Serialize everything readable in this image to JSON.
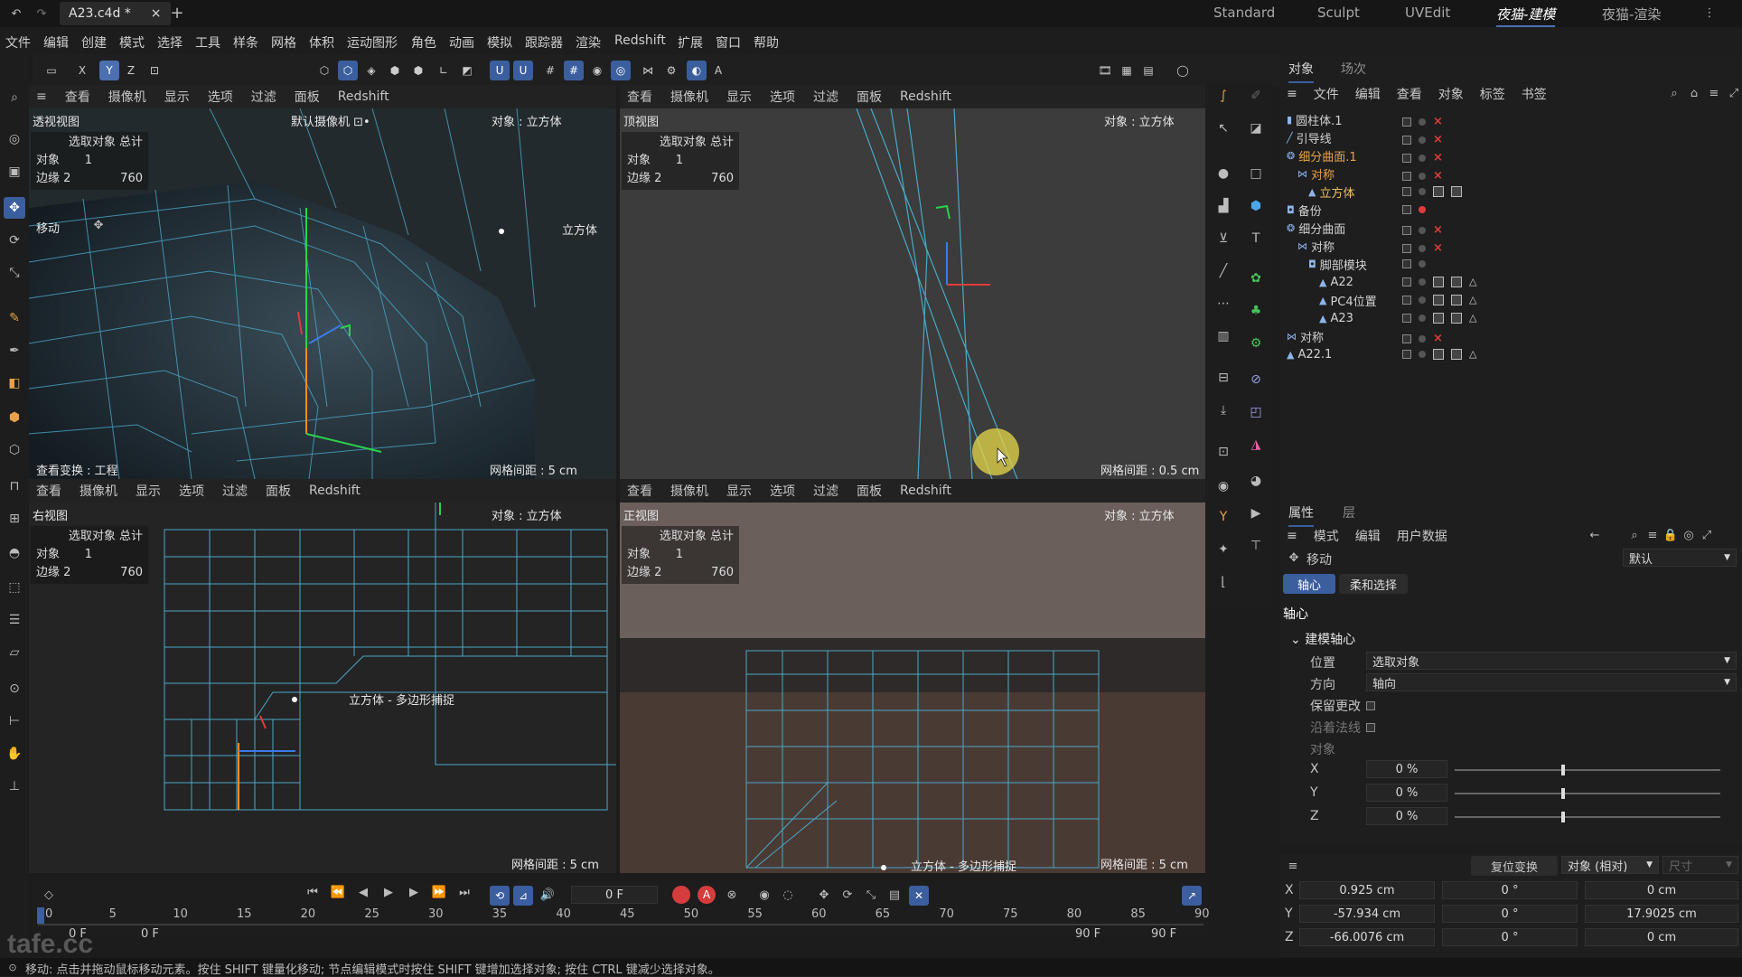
{
  "titlebar": {
    "doc_tab": "A23.c4d *",
    "layouts": [
      "Standard",
      "Sculpt",
      "UVEdit",
      "夜猫-建模",
      "夜猫-渲染"
    ]
  },
  "menu": [
    "文件",
    "编辑",
    "创建",
    "模式",
    "选择",
    "工具",
    "样条",
    "网格",
    "体积",
    "运动图形",
    "角色",
    "动画",
    "模拟",
    "跟踪器",
    "渲染",
    "Redshift",
    "扩展",
    "窗口",
    "帮助"
  ],
  "toolbar": {
    "x": "X",
    "y": "Y",
    "z": "Z"
  },
  "viewport_menu": [
    "查看",
    "摄像机",
    "显示",
    "选项",
    "过滤",
    "面板",
    "Redshift"
  ],
  "viewports": [
    {
      "name": "透视视图",
      "camera": "默认摄像机 ⊡•",
      "object": "对象 : 立方体",
      "grid": "网格间距 : 5 cm",
      "extra": "查看变换 : 工程",
      "label3d": "立方体",
      "tool": "移动"
    },
    {
      "name": "顶视图",
      "object": "对象 : 立方体",
      "grid": "网格间距 : 0.5 cm"
    },
    {
      "name": "右视图",
      "object": "对象 : 立方体",
      "grid": "网格间距 : 5 cm",
      "label3d": "立方体 - 多边形捕捉"
    },
    {
      "name": "正视图",
      "object": "对象 : 立方体",
      "grid": "网格间距 : 5 cm",
      "label3d": "立方体 - 多边形捕捉"
    }
  ],
  "stats": {
    "header": "选取对象 总计",
    "obj_label": "对象",
    "obj_val": "1",
    "edge_label": "边缘",
    "edge_val": "2",
    "edge_total": "760"
  },
  "object_panel": {
    "tabs": [
      "对象",
      "场次"
    ],
    "menu": [
      "文件",
      "编辑",
      "查看",
      "对象",
      "标签",
      "书签"
    ],
    "items": [
      {
        "name": "圆柱体.1",
        "indent": 0,
        "color": "#d2d2d2"
      },
      {
        "name": "引导线",
        "indent": 0,
        "color": "#d2d2d2"
      },
      {
        "name": "细分曲面.1",
        "indent": 0,
        "color": "#e8a24a"
      },
      {
        "name": "对称",
        "indent": 1,
        "color": "#e8a24a"
      },
      {
        "name": "立方体",
        "indent": 2,
        "color": "#f0c060"
      },
      {
        "name": "备份",
        "indent": 0,
        "color": "#d2d2d2"
      },
      {
        "name": "细分曲面",
        "indent": 0,
        "color": "#d2d2d2"
      },
      {
        "name": "对称",
        "indent": 1,
        "color": "#d2d2d2"
      },
      {
        "name": "脚部模块",
        "indent": 2,
        "color": "#d2d2d2"
      },
      {
        "name": "A22",
        "indent": 3,
        "color": "#d2d2d2"
      },
      {
        "name": "PC4位置",
        "indent": 3,
        "color": "#d2d2d2"
      },
      {
        "name": "A23",
        "indent": 3,
        "color": "#d2d2d2"
      },
      {
        "name": "对称",
        "indent": 0,
        "color": "#d2d2d2"
      },
      {
        "name": "A22.1",
        "indent": 0,
        "color": "#d2d2d2"
      }
    ]
  },
  "attr_panel": {
    "tabs": [
      "属性",
      "层"
    ],
    "menu": [
      "模式",
      "编辑",
      "用户数据"
    ],
    "tool": "移动",
    "preset": "默认",
    "subtabs": [
      "轴心",
      "柔和选择"
    ],
    "section": "轴心",
    "group": "建模轴心",
    "position_label": "位置",
    "position_value": "选取对象",
    "direction_label": "方向",
    "direction_value": "轴向",
    "keep_changes": "保留更改",
    "along_normal": "沿着法线",
    "object_label": "对象",
    "axes": [
      {
        "axis": "X",
        "value": "0 %",
        "level": 0.5
      },
      {
        "axis": "Y",
        "value": "0 %",
        "level": 0.5
      },
      {
        "axis": "Z",
        "value": "0 %",
        "level": 0.5
      }
    ]
  },
  "coords": {
    "reset": "复位变换",
    "mode": "对象 (相对)",
    "size": "尺寸",
    "rows": [
      {
        "axis": "X",
        "pos": "0.925 cm",
        "rot": "0 °",
        "size": "0 cm"
      },
      {
        "axis": "Y",
        "pos": "-57.934 cm",
        "rot": "0 °",
        "size": "17.9025 cm"
      },
      {
        "axis": "Z",
        "pos": "-66.0076 cm",
        "rot": "0 °",
        "size": "0 cm"
      }
    ]
  },
  "timeline": {
    "frame": "0 F",
    "ticks": [
      "0",
      "5",
      "10",
      "15",
      "20",
      "25",
      "30",
      "35",
      "40",
      "45",
      "50",
      "55",
      "60",
      "65",
      "70",
      "75",
      "80",
      "85",
      "90"
    ],
    "start": "0 F",
    "start2": "0 F",
    "end1": "90 F",
    "end2": "90 F"
  },
  "status": "移动: 点击并拖动鼠标移动元素。按住 SHIFT 键量化移动; 节点编辑模式时按住 SHIFT 键增加选择对象; 按住 CTRL 键减少选择对象。",
  "watermark": "tafe.cc",
  "colors": {
    "accent": "#3b5e9e",
    "wire": "#4aa8c8",
    "red": "#e23b3b",
    "orange": "#e8a24a"
  }
}
